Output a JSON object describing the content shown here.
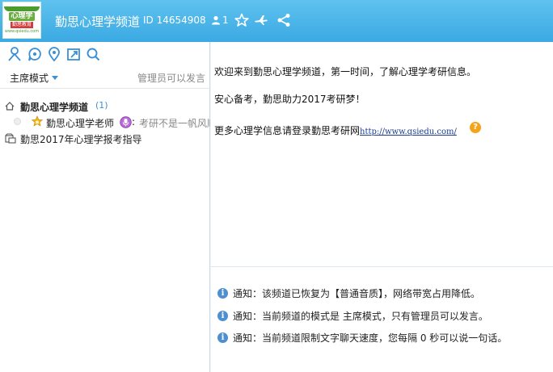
{
  "header": {
    "logo": {
      "line1": "心理学",
      "line2": "勤思教育",
      "line3": "www.qsiedu.com"
    },
    "title": "勤思心理学频道",
    "channel_id": "ID 14654908",
    "user_count": "1",
    "icons": [
      "user-icon",
      "star-icon",
      "plane-icon",
      "share-icon"
    ]
  },
  "left": {
    "toolbar_icons": [
      "person-icon",
      "chat-bubble-icon",
      "location-pin-icon",
      "export-icon",
      "search-icon"
    ],
    "mode": {
      "label": "主席模式",
      "right_text": "管理员可以发言"
    },
    "tree": [
      {
        "label": "勤思心理学频道",
        "count": "(1)"
      },
      {
        "label": "勤思心理学老师",
        "status": "考研不是一帆风顺"
      },
      {
        "label": "勤思2017年心理学报考指导"
      }
    ]
  },
  "main": {
    "messages": [
      "欢迎来到勤思心理学频道，第一时间，了解心理学考研信息。",
      "安心备考，勤思助力2017考研梦！",
      "更多心理学信息请登录勤思考研网"
    ],
    "link": "http://www.qsiedu.com/",
    "help": "?"
  },
  "notices": [
    "通知：该频道已恢复为【普通音质】，网络带宽占用降低。",
    "通知：当前频道的模式是 主席模式，只有管理员可以发言。",
    "通知：当前频道限制文字聊天速度，您每隔 0 秒可以说一句话。"
  ],
  "colors": {
    "header": "#3ba9e3",
    "accent": "#3b8fd6",
    "info": "#4e8fd0"
  }
}
